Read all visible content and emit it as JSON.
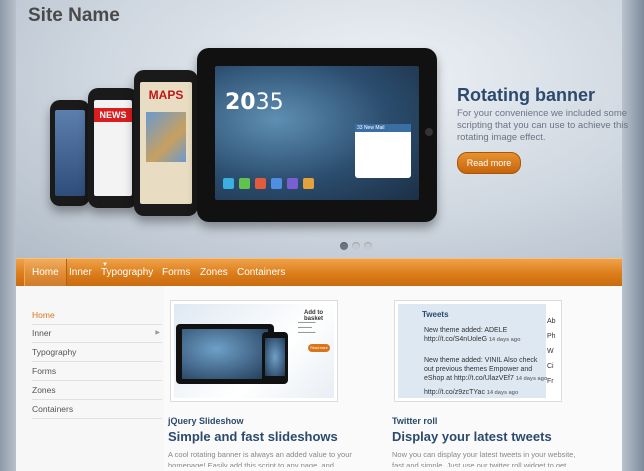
{
  "site": {
    "name": "Site Name"
  },
  "banner": {
    "title": "Rotating banner",
    "text": "For your convenience we included some scripting that you can use to achieve this rotating image effect.",
    "button": "Read more",
    "slides": 3,
    "active_slide": 1,
    "device_labels": {
      "news": "NEWS",
      "maps": "MAPS"
    },
    "tablet": {
      "hour": "20",
      "minute": "35",
      "mail_title": "33 New Mail"
    }
  },
  "nav": {
    "items": [
      "Home",
      "Inner",
      "Typography",
      "Forms",
      "Zones",
      "Containers"
    ],
    "active": "Home"
  },
  "sidebar": {
    "items": [
      "Home",
      "Inner",
      "Typography",
      "Forms",
      "Zones",
      "Containers"
    ],
    "active": "Home"
  },
  "cards": [
    {
      "overline": "jQuery Slideshow",
      "title": "Simple and fast slideshows",
      "text": "A cool rotating banner is always an added value to your homepage! Easily add this script to any page, and",
      "thumb": {
        "heading": "Add to basket",
        "button": "Read more"
      }
    },
    {
      "overline": "Twitter roll",
      "title": "Display your latest tweets",
      "text": "Now you can display your latest tweets in your website, fast and simple. Just use our twitter roll widget to get your",
      "thumb": {
        "heading": "Tweets",
        "tweets": [
          {
            "text": "New theme added: ADELE http://t.co/S4nUoleG",
            "time": "14 days ago"
          },
          {
            "text": "New theme added: VINIL Also check out previous themes Empower and eShop at http://t.co/UlazVEf7",
            "time": "14 days ago"
          },
          {
            "text": "http://t.co/z9zcTYac",
            "time": "14 days ago"
          }
        ],
        "side_letters": [
          "Ab",
          "Ph",
          "W",
          "Ci",
          "Fr"
        ]
      }
    }
  ],
  "colors": {
    "accent": "#d8751b",
    "heading": "#2c4a6e"
  }
}
